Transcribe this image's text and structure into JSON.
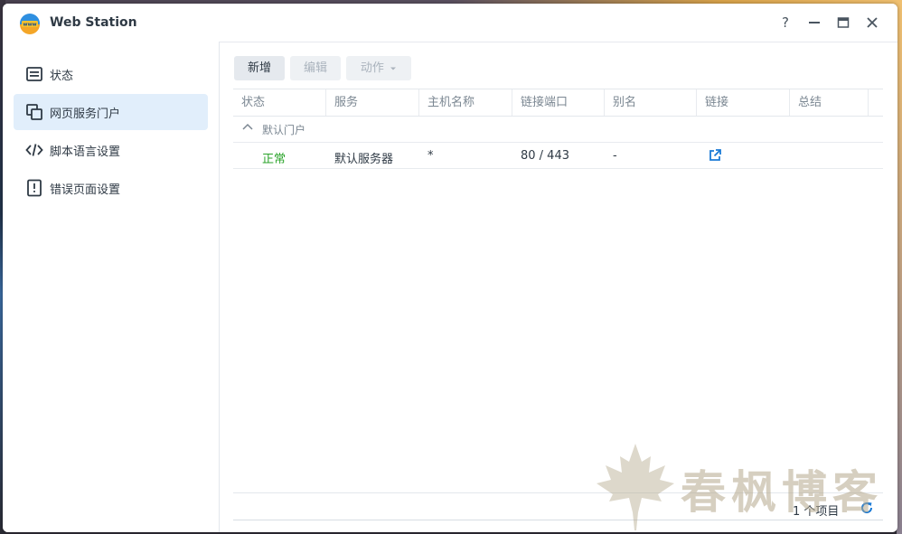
{
  "window": {
    "title": "Web Station",
    "controls": {
      "help": "?",
      "minimize": "—",
      "maximize": "▭",
      "close": "✕"
    }
  },
  "sidebar": {
    "items": [
      {
        "label": "状态",
        "icon": "status-list-icon",
        "active": false
      },
      {
        "label": "网页服务门户",
        "icon": "web-portal-icon",
        "active": true
      },
      {
        "label": "脚本语言设置",
        "icon": "code-icon",
        "active": false
      },
      {
        "label": "错误页面设置",
        "icon": "error-page-icon",
        "active": false
      }
    ]
  },
  "toolbar": {
    "add_label": "新增",
    "edit_label": "编辑",
    "action_label": "动作"
  },
  "grid": {
    "columns": [
      "状态",
      "服务",
      "主机名称",
      "链接端口",
      "别名",
      "链接",
      "总结"
    ],
    "groups": [
      {
        "label": "默认门户",
        "rows": [
          {
            "status": "正常",
            "service": "默认服务器",
            "hostname": "*",
            "port": "80 / 443",
            "alias": "-",
            "link_icon": "external-link-icon",
            "summary": ""
          }
        ]
      }
    ]
  },
  "footer": {
    "count_text": "1 个项目"
  },
  "watermark": {
    "text": "春枫博客"
  },
  "colors": {
    "accent": "#1a7ad6",
    "active_bg": "#e1eefb",
    "status_ok": "#29a329"
  }
}
